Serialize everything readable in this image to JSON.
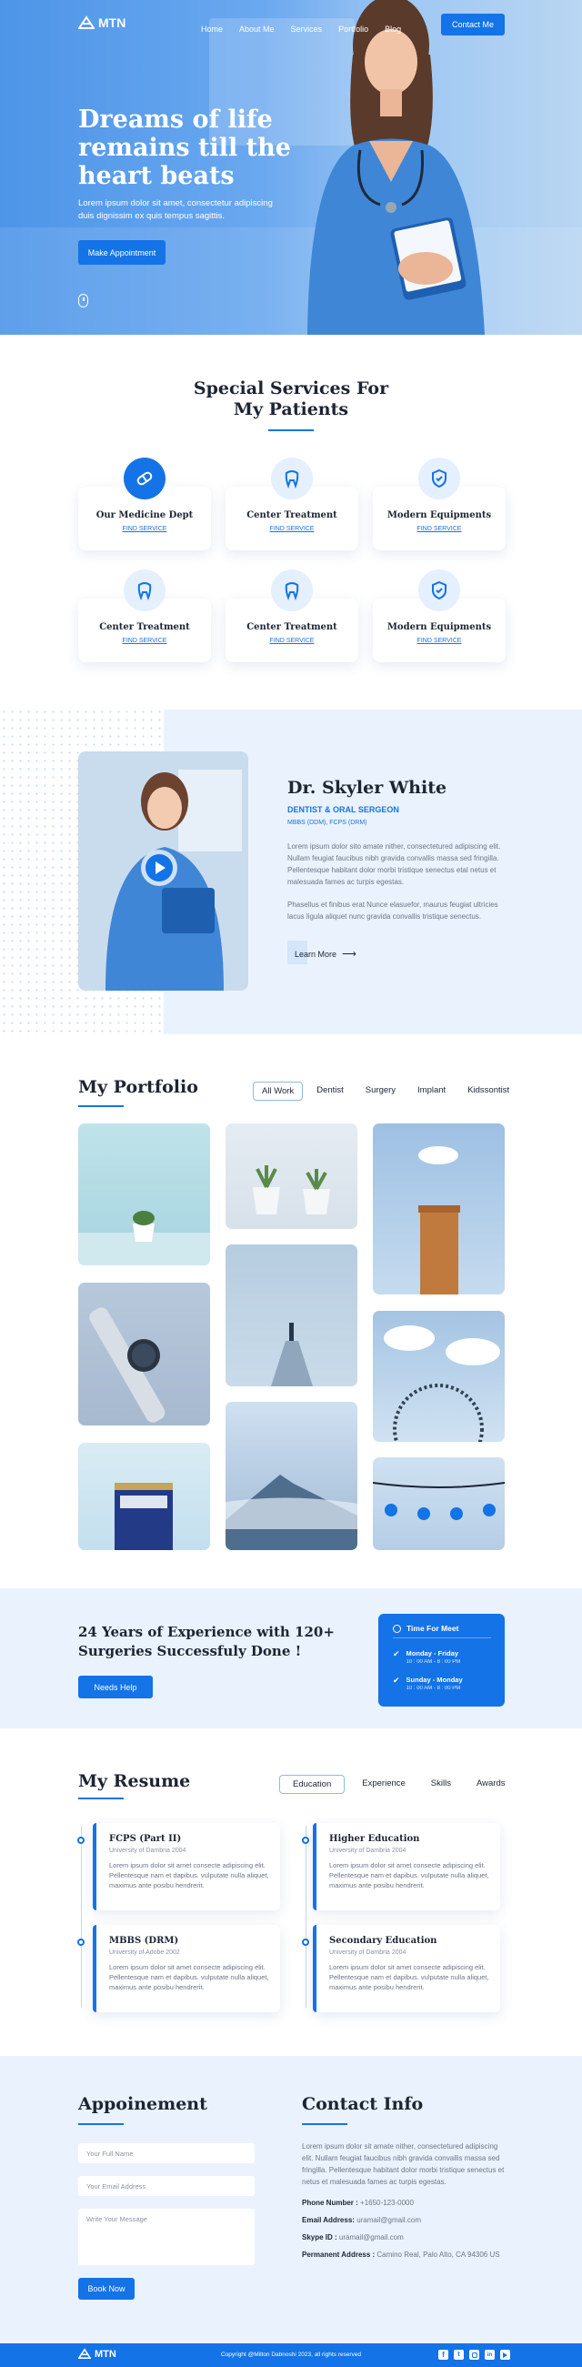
{
  "brand": {
    "name": "MTN",
    "accent": "#1473e6"
  },
  "nav": {
    "items": [
      "Home",
      "About Me",
      "Services",
      "Portfolio",
      "Blog"
    ],
    "cta": "Contact Me"
  },
  "hero": {
    "title_lines": [
      "Dreams of life",
      "remains till the",
      "heart beats"
    ],
    "subtitle_lines": [
      "Lorem ipsum dolor sit amet, consectetur adipiscing",
      "duis dignissim ex quis tempus sagittis."
    ],
    "button": "Make Appointment"
  },
  "services": {
    "title_lines": [
      "Special Services For",
      "My Patients"
    ],
    "cards": [
      {
        "title": "Our Medicine Dept",
        "link": "FIND SERVICE",
        "icon": "pill-icon"
      },
      {
        "title": "Center Treatment",
        "link": "FIND SERVICE",
        "icon": "tooth-icon"
      },
      {
        "title": "Modern Equipments",
        "link": "FIND SERVICE",
        "icon": "shield-icon"
      },
      {
        "title": "Center Treatment",
        "link": "FIND SERVICE",
        "icon": "tooth-icon"
      },
      {
        "title": "Center Treatment",
        "link": "FIND SERVICE",
        "icon": "tooth-icon"
      },
      {
        "title": "Modern Equipments",
        "link": "FIND SERVICE",
        "icon": "shield-icon"
      }
    ]
  },
  "doctor": {
    "name": "Dr. Skyler White",
    "role": "DENTIST & ORAL SERGEON",
    "degrees": "MBBS (DDM), FCPS (DRM)",
    "para1": "Lorem ipsum dolor sito amate nither, consectetured adipiscing elit. Nullam feugiat faucibus nibh gravida convallis massa sed fringilla. Pellentesque habitant dolor morbi tristique senectus etal netus et malesuada fames ac turpis egestas.",
    "para2": "Phasellus et finibus erat Nunce elasuefor, maurus feugiat ultricies lacus ligula aliquet nunc gravida convallis tristique senectus.",
    "button": "Learn More"
  },
  "portfolio": {
    "title": "My Portfolio",
    "tabs": [
      "All Work",
      "Dentist",
      "Surgery",
      "Implant",
      "Kidssontist"
    ],
    "active_tab": 0
  },
  "experience": {
    "title_lines": [
      "24 Years of Experience with 120+",
      "Surgeries Successfuly Done !"
    ],
    "button": "Needs Help",
    "hours": {
      "title": "Time For Meet",
      "rows": [
        {
          "day": "Monday - Friday",
          "time": "10 : 00 AM - 8 : 00 PM"
        },
        {
          "day": "Sunday - Monday",
          "time": "10 : 00 AM - 8 : 00 PM"
        }
      ]
    }
  },
  "resume": {
    "title": "My Resume",
    "tabs": [
      "Education",
      "Experience",
      "Skills",
      "Awards"
    ],
    "active_tab": 0,
    "items": [
      {
        "title": "FCPS (Part II)",
        "sub": "University of Dambria 2004",
        "desc": "Lorem ipsum dolor sit amet consecte adipiscing elit. Pellentesque nam et dapibus. vulputate nulla aliquet, maximus ante posibu hendrerit."
      },
      {
        "title": "Higher Education",
        "sub": "University of Dambria 2004",
        "desc": "Lorem ipsum dolor sit amet consecte adipiscing elit. Pellentesque nam et dapibus. vulputate nulla aliquet, maximus ante posibu hendrerit."
      },
      {
        "title": "MBBS (DRM)",
        "sub": "University of Adobe 2002",
        "desc": "Lorem ipsum dolor sit amet consecte adipiscing elit. Pellentesque nam et dapibus. vulputate nulla aliquet, maximus ante posibu hendrerit."
      },
      {
        "title": "Secondary Education",
        "sub": "University of Dambria 2004",
        "desc": "Lorem ipsum dolor sit amet consecte adipiscing elit. Pellentesque nam et dapibus. vulputate nulla aliquet, maximus ante posibu hendrerit."
      }
    ]
  },
  "appointment": {
    "title": "Appoinement",
    "name_placeholder": "Your Full Name",
    "email_placeholder": "Your Email Address",
    "message_placeholder": "Write Your Message",
    "button": "Book Now"
  },
  "contact": {
    "title": "Contact Info",
    "text": "Lorem ipsum dolor sit amate nither, consectetured adipiscing elit. Nullam feugiat faucibus nibh gravida convallis massa sed fringilla. Pellentesque habitant dolor morbi tristique senectus et netus et malesuada fames ac turpis egestas.",
    "rows": [
      {
        "label": "Phone Number :",
        "value": "+1650-123-0000"
      },
      {
        "label": "Email Address:",
        "value": "uramail@gmail.com"
      },
      {
        "label": "Skype ID :",
        "value": "uramail@gmail.com"
      },
      {
        "label": "Permanent Address :",
        "value": "Camino Real, Palo Alto, CA 94306 US"
      }
    ]
  },
  "footer": {
    "copyright": "Copyright @Milton Dabnoshi 2023, all rights reserved"
  }
}
